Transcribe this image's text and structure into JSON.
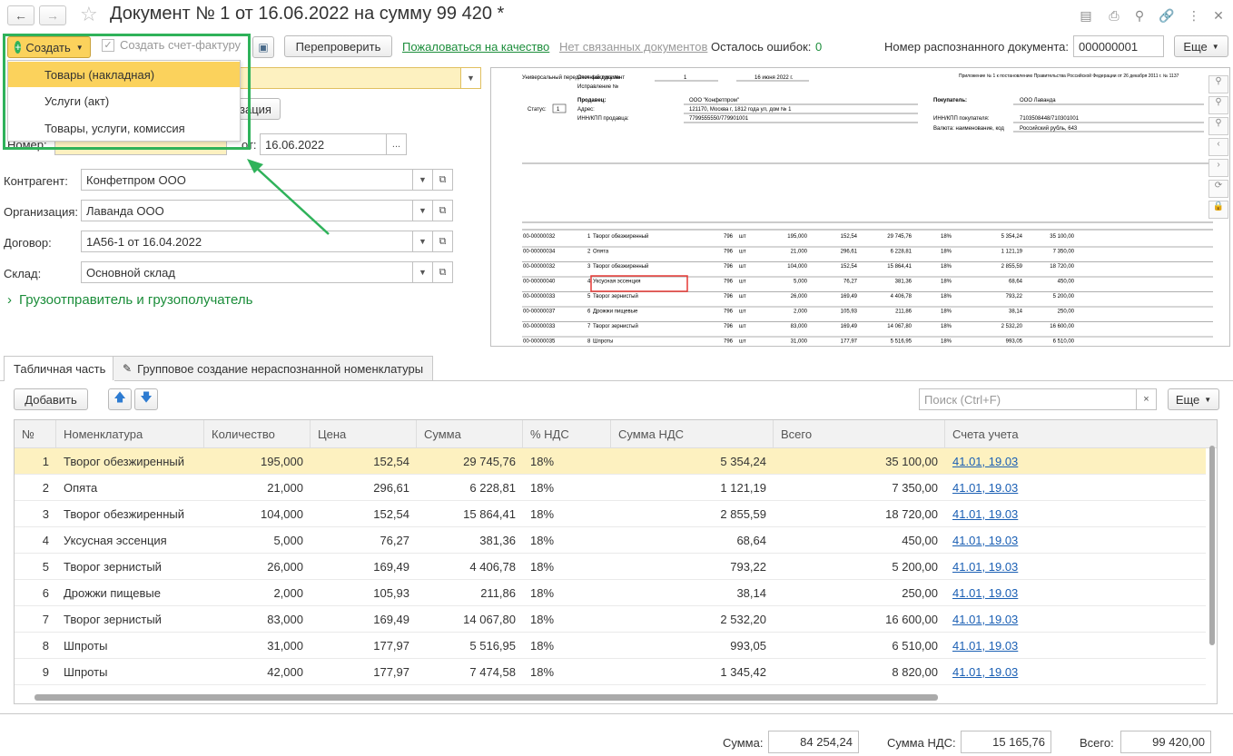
{
  "window": {
    "title": "Документ № 1 от 16.06.2022 на сумму 99 420 *"
  },
  "toolbar": {
    "create_label": "Создать",
    "create_invoice_label": "Создать счет-фактуру",
    "recheck_label": "Перепроверить",
    "complain_link": "Пожаловаться на качество",
    "no_docs_link": "Нет связанных документов",
    "errors_label": "Осталось ошибок:",
    "errors_count": "0",
    "recognized_doc_label": "Номер распознанного документа:",
    "recognized_doc_value": "000000001",
    "more_label": "Еще"
  },
  "create_menu": {
    "items": [
      "Товары (накладная)",
      "Услуги (акт)",
      "Товары, услуги, комиссия"
    ]
  },
  "form": {
    "partial_button": "зация",
    "number_label": "Номер:",
    "date_prefix": "от:",
    "date_value": "16.06.2022",
    "contractor_label": "Контрагент:",
    "contractor_value": "Конфетпром ООО",
    "org_label": "Организация:",
    "org_value": "Лаванда ООО",
    "contract_label": "Договор:",
    "contract_value": "1А56-1 от 16.04.2022",
    "warehouse_label": "Склад:",
    "warehouse_value": "Основной склад",
    "shipper_section": "Грузоотправитель и грузополучатель"
  },
  "preview": {
    "upd_title": "Универсальный передаточный документ",
    "status_label": "Статус:",
    "status_value": "1",
    "invoice_no_label": "Счет-фактура №",
    "invoice_no": "1",
    "invoice_date": "16 июня 2022 г.",
    "correction_label": "Исправление №",
    "seller_label": "Продавец:",
    "seller": "ООО \"Конфетпром\"",
    "address_label": "Адрес:",
    "seller_address": "121170, Москва г, 1812 года ул, дом № 1",
    "inn_label": "ИНН/КПП продавца:",
    "seller_inn": "7799555550/779901001",
    "buyer_label": "Покупатель:",
    "buyer": "ООО Лаванда",
    "buyer_inn_label": "ИНН/КПП покупателя:",
    "buyer_inn": "7103508448/710301001",
    "currency_label": "Валюта: наименование, код",
    "currency": "Российский рубль, 643",
    "header_note": "Приложение № 1 к постановлению Правительства Российской Федерации от 26 декабря 2011 г. № 1137",
    "rows": [
      {
        "code": "00-00000032",
        "n": "1",
        "name": "Творог обезжиренный",
        "okei": "796",
        "unit": "шт",
        "qty": "195,000",
        "price": "152,54",
        "sum": "29 745,76",
        "vat": "18%",
        "nds": "5 354,24",
        "total": "35 100,00"
      },
      {
        "code": "00-00000034",
        "n": "2",
        "name": "Опята",
        "okei": "796",
        "unit": "шт",
        "qty": "21,000",
        "price": "296,61",
        "sum": "6 228,81",
        "vat": "18%",
        "nds": "1 121,19",
        "total": "7 350,00"
      },
      {
        "code": "00-00000032",
        "n": "3",
        "name": "Творог обезжиренный",
        "okei": "796",
        "unit": "шт",
        "qty": "104,000",
        "price": "152,54",
        "sum": "15 864,41",
        "vat": "18%",
        "nds": "2 855,59",
        "total": "18 720,00"
      },
      {
        "code": "00-00000040",
        "n": "4",
        "name": "Уксусная эссенция",
        "okei": "796",
        "unit": "шт",
        "qty": "5,000",
        "price": "76,27",
        "sum": "381,36",
        "vat": "18%",
        "nds": "68,64",
        "total": "450,00"
      },
      {
        "code": "00-00000033",
        "n": "5",
        "name": "Творог зернистый",
        "okei": "796",
        "unit": "шт",
        "qty": "26,000",
        "price": "169,49",
        "sum": "4 406,78",
        "vat": "18%",
        "nds": "793,22",
        "total": "5 200,00"
      },
      {
        "code": "00-00000037",
        "n": "6",
        "name": "Дрожжи пищевые",
        "okei": "796",
        "unit": "шт",
        "qty": "2,000",
        "price": "105,93",
        "sum": "211,86",
        "vat": "18%",
        "nds": "38,14",
        "total": "250,00"
      },
      {
        "code": "00-00000033",
        "n": "7",
        "name": "Творог зернистый",
        "okei": "796",
        "unit": "шт",
        "qty": "83,000",
        "price": "169,49",
        "sum": "14 067,80",
        "vat": "18%",
        "nds": "2 532,20",
        "total": "16 600,00"
      },
      {
        "code": "00-00000035",
        "n": "8",
        "name": "Шпроты",
        "okei": "796",
        "unit": "шт",
        "qty": "31,000",
        "price": "177,97",
        "sum": "5 516,95",
        "vat": "18%",
        "nds": "993,05",
        "total": "6 510,00"
      }
    ]
  },
  "tabs": [
    "Табличная часть",
    "Групповое создание нераспознанной номенклатуры"
  ],
  "table_toolbar": {
    "add_label": "Добавить",
    "search_placeholder": "Поиск (Ctrl+F)",
    "more_label": "Еще"
  },
  "table": {
    "columns": [
      "№",
      "Номенклатура",
      "Количество",
      "Цена",
      "Сумма",
      "% НДС",
      "Сумма НДС",
      "Всего",
      "Счета учета"
    ],
    "rows": [
      [
        "1",
        "Творог обезжиренный",
        "195,000",
        "152,54",
        "29 745,76",
        "18%",
        "5 354,24",
        "35 100,00",
        "41.01, 19.03"
      ],
      [
        "2",
        "Опята",
        "21,000",
        "296,61",
        "6 228,81",
        "18%",
        "1 121,19",
        "7 350,00",
        "41.01, 19.03"
      ],
      [
        "3",
        "Творог обезжиренный",
        "104,000",
        "152,54",
        "15 864,41",
        "18%",
        "2 855,59",
        "18 720,00",
        "41.01, 19.03"
      ],
      [
        "4",
        "Уксусная эссенция",
        "5,000",
        "76,27",
        "381,36",
        "18%",
        "68,64",
        "450,00",
        "41.01, 19.03"
      ],
      [
        "5",
        "Творог зернистый",
        "26,000",
        "169,49",
        "4 406,78",
        "18%",
        "793,22",
        "5 200,00",
        "41.01, 19.03"
      ],
      [
        "6",
        "Дрожжи пищевые",
        "2,000",
        "105,93",
        "211,86",
        "18%",
        "38,14",
        "250,00",
        "41.01, 19.03"
      ],
      [
        "7",
        "Творог зернистый",
        "83,000",
        "169,49",
        "14 067,80",
        "18%",
        "2 532,20",
        "16 600,00",
        "41.01, 19.03"
      ],
      [
        "8",
        "Шпроты",
        "31,000",
        "177,97",
        "5 516,95",
        "18%",
        "993,05",
        "6 510,00",
        "41.01, 19.03"
      ],
      [
        "9",
        "Шпроты",
        "42,000",
        "177,97",
        "7 474,58",
        "18%",
        "1 345,42",
        "8 820,00",
        "41.01, 19.03"
      ]
    ]
  },
  "totals": {
    "sum_label": "Сумма:",
    "sum_value": "84 254,24",
    "nds_label": "Сумма НДС:",
    "nds_value": "15 165,76",
    "total_label": "Всего:",
    "total_value": "99 420,00"
  },
  "colors": {
    "accent_green": "#2fb25a",
    "menu_selected": "#fbd25c",
    "row_selected": "#fdf1c0",
    "link_blue": "#1a5fb4"
  }
}
